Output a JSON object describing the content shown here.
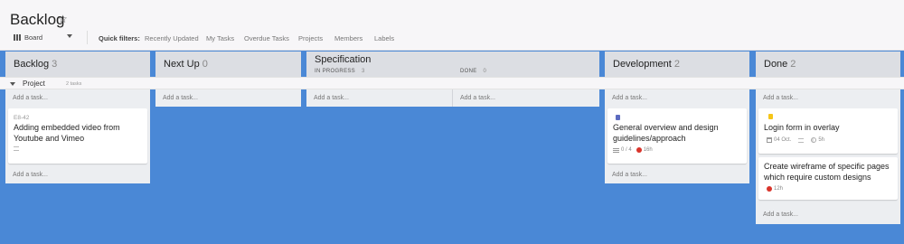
{
  "header": {
    "title": "Backlog",
    "view": "Board",
    "quick_filters_label": "Quick filters:",
    "quick_filters": [
      "Recently Updated",
      "My Tasks",
      "Overdue Tasks",
      "Projects",
      "Members",
      "Labels"
    ]
  },
  "columns": [
    {
      "title": "Backlog",
      "count": "3"
    },
    {
      "title": "Next Up",
      "count": "0"
    },
    {
      "title": "Specification",
      "count": "",
      "sub": [
        {
          "label": "IN PROGRESS",
          "count": "3"
        },
        {
          "label": "DONE",
          "count": "0"
        }
      ]
    },
    {
      "title": "Development",
      "count": "2"
    },
    {
      "title": "Done",
      "count": "2"
    }
  ],
  "swimlane": {
    "name": "Project",
    "count": "2 tasks"
  },
  "add_task_label": "Add a task...",
  "cards": {
    "backlog": {
      "key": "E8-42",
      "title": "Adding embedded video from Youtube and Vimeo"
    },
    "development": {
      "title": "General overview and design guidelines/approach",
      "checklist": "0 / 4",
      "estimate": "16h"
    },
    "done1": {
      "title": "Login form in overlay",
      "date": "04 Oct.",
      "estimate": "5h"
    },
    "done2": {
      "title": "Create wireframe of specific pages which require custom designs",
      "estimate": "12h"
    }
  },
  "colors": {
    "background": "#4a88d6",
    "accent_red": "#d9342b",
    "label_blue": "#5c6bc0",
    "label_yellow": "#f5c518"
  }
}
